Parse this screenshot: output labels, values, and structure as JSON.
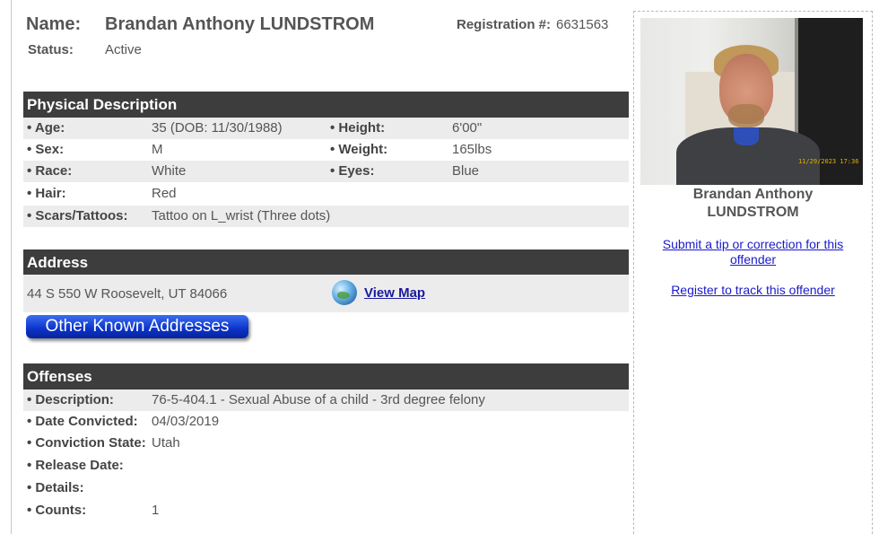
{
  "header": {
    "name_label": "Name:",
    "name_value": "Brandan Anthony LUNDSTROM",
    "registration_label": "Registration #:",
    "registration_value": "6631563",
    "status_label": "Status:",
    "status_value": "Active"
  },
  "physical": {
    "title": "Physical Description",
    "age_label": "• Age:",
    "age_value": "35  (DOB: 11/30/1988)",
    "height_label": "• Height:",
    "height_value": "6'00\"",
    "sex_label": "• Sex:",
    "sex_value": "M",
    "weight_label": "• Weight:",
    "weight_value": "165lbs",
    "race_label": "• Race:",
    "race_value": "White",
    "eyes_label": "• Eyes:",
    "eyes_value": "Blue",
    "hair_label": "• Hair:",
    "hair_value": "Red",
    "scars_label": "• Scars/Tattoos:",
    "scars_value": "Tattoo on L_wrist (Three dots)"
  },
  "address": {
    "title": "Address",
    "line": "44 S 550 W Roosevelt, UT 84066",
    "view_map": "View Map",
    "other_button": "Other Known Addresses"
  },
  "offenses": {
    "title": "Offenses",
    "description_label": "• Description:",
    "description_value": "76-5-404.1 - Sexual Abuse of a child - 3rd degree felony",
    "date_label": "• Date Convicted:",
    "date_value": "04/03/2019",
    "state_label": "• Conviction State:",
    "state_value": "Utah",
    "release_label": "• Release Date:",
    "release_value": "",
    "details_label": "• Details:",
    "details_value": "",
    "counts_label": "• Counts:",
    "counts_value": "1"
  },
  "sidebar": {
    "photo_stamp": "11/29/2023 17:36",
    "name_line1": "Brandan Anthony",
    "name_line2": "LUNDSTROM",
    "tip_link": "Submit a tip or correction for this offender",
    "track_link": "Register to track this offender"
  },
  "colors": {
    "section_header_bg": "#3d3d3d",
    "row_shade": "#ececec",
    "link": "#1a1acc",
    "button_blue": "#0b33c9"
  }
}
